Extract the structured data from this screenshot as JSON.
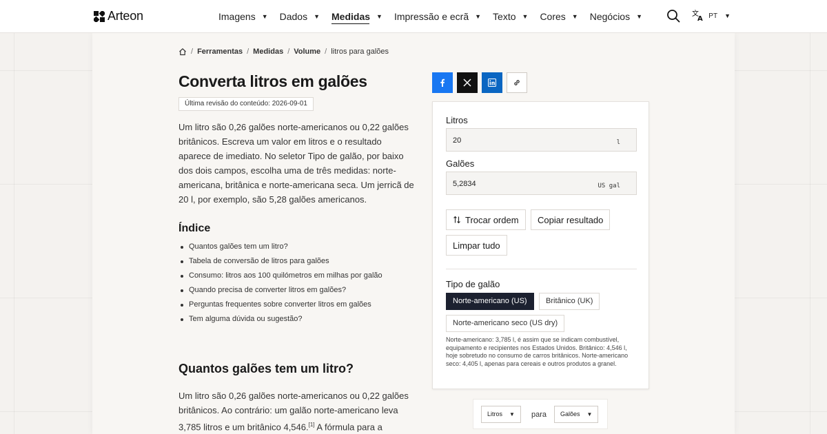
{
  "header": {
    "logo_text": "Arteon",
    "nav": [
      {
        "label": "Imagens",
        "active": false
      },
      {
        "label": "Dados",
        "active": false
      },
      {
        "label": "Medidas",
        "active": true
      },
      {
        "label": "Impressão e ecrã",
        "active": false
      },
      {
        "label": "Texto",
        "active": false
      },
      {
        "label": "Cores",
        "active": false
      },
      {
        "label": "Negócios",
        "active": false
      }
    ],
    "caret": "▼",
    "lang": "PT"
  },
  "breadcrumb": {
    "items": [
      "Ferramentas",
      "Medidas",
      "Volume"
    ],
    "current": "litros para galões",
    "sep": "/"
  },
  "article": {
    "title": "Converta litros em galões",
    "revision": "Última revisão do conteúdo: 2026-09-01",
    "intro": "Um litro são 0,26 galões norte-americanos ou 0,22 galões britânicos. Escreva um valor em litros e o resultado aparece de imediato. No seletor Tipo de galão, por baixo dos dois campos, escolha uma de três medidas: norte-americana, britânica e norte-americana seca. Um jerricã de 20 l, por exemplo, são 5,28 galões americanos.",
    "index_title": "Índice",
    "index": [
      "Quantos galões tem um litro?",
      "Tabela de conversão de litros para galões",
      "Consumo: litros aos 100 quilómetros em milhas por galão",
      "Quando precisa de converter litros em galões?",
      "Perguntas frequentes sobre converter litros em galões",
      "Tem alguma dúvida ou sugestão?"
    ],
    "h2": "Quantos galões tem um litro?",
    "para2_before_sup": "Um litro são 0,26 galões norte-americanos ou 0,22 galões britânicos. Ao contrário: um galão norte-americano leva 3,785 litros e um britânico 4,546.",
    "para2_sup": "[1]",
    "para2_after_sup": " A fórmula para a"
  },
  "converter": {
    "liters_label": "Litros",
    "liters_value": "20",
    "liters_unit": "l",
    "gallons_label": "Galões",
    "gallons_value": "5,2834",
    "gallons_unit": "US gal",
    "swap_label": "Trocar ordem",
    "copy_label": "Copiar resultado",
    "clear_label": "Limpar tudo",
    "gallon_type_label": "Tipo de galão",
    "options": [
      {
        "label": "Norte-americano (US)",
        "selected": true
      },
      {
        "label": "Britânico (UK)",
        "selected": false
      },
      {
        "label": "Norte-americano seco (US dry)",
        "selected": false
      }
    ],
    "note": "Norte-americano: 3,785 l, é assim que se indicam combustível, equipamento e recipientes nos Estados Unidos. Britânico: 4,546 l, hoje sobretudo no consumo de carros britânicos. Norte-americano seco: 4,405 l, apenas para cereais e outros produtos a granel."
  },
  "unit_selector": {
    "from": "Litros",
    "to_word": "para",
    "to": "Galões",
    "caret": "▼"
  },
  "colors": {
    "facebook": "#1877f2",
    "x": "#111111",
    "linkedin": "#0a66c2",
    "selected_chip": "#1c2130"
  }
}
